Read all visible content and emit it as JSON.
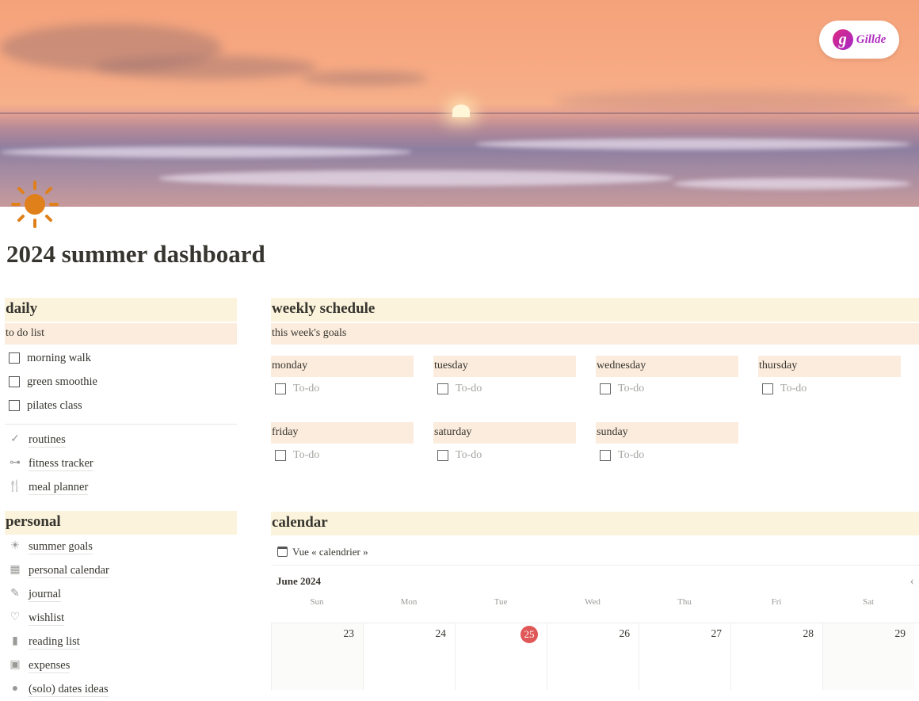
{
  "logo": {
    "brand": "Gillde"
  },
  "page": {
    "title": "2024 summer dashboard",
    "icon": "sun-icon"
  },
  "daily": {
    "heading": "daily",
    "subheading": "to do list",
    "todos": [
      "morning walk",
      "green smoothie",
      "pilates class"
    ],
    "links": [
      {
        "label": "routines",
        "icon": "checkmark-icon"
      },
      {
        "label": "fitness tracker",
        "icon": "dumbbell-icon"
      },
      {
        "label": "meal planner",
        "icon": "fork-knife-icon"
      }
    ]
  },
  "personal": {
    "heading": "personal",
    "links": [
      {
        "label": "summer goals",
        "icon": "sun-icon"
      },
      {
        "label": "personal calendar",
        "icon": "calendar-icon"
      },
      {
        "label": "journal",
        "icon": "brush-icon"
      },
      {
        "label": "wishlist",
        "icon": "heart-icon"
      },
      {
        "label": "reading list",
        "icon": "book-icon"
      },
      {
        "label": "expenses",
        "icon": "money-icon"
      },
      {
        "label": "(solo) dates ideas",
        "icon": "cloud-icon"
      }
    ]
  },
  "weekly": {
    "heading": "weekly schedule",
    "subheading": "this week's goals",
    "todo_placeholder": "To-do",
    "days": [
      "monday",
      "tuesday",
      "wednesday",
      "thursday",
      "friday",
      "saturday",
      "sunday"
    ]
  },
  "calendar": {
    "heading": "calendar",
    "view_label": "Vue « calendrier »",
    "month": "June 2024",
    "weekdays": [
      "Sun",
      "Mon",
      "Tue",
      "Wed",
      "Thu",
      "Fri",
      "Sat"
    ],
    "dates": [
      "23",
      "24",
      "25",
      "26",
      "27",
      "28",
      "29"
    ],
    "today": "25",
    "today_color": "#e05757"
  }
}
